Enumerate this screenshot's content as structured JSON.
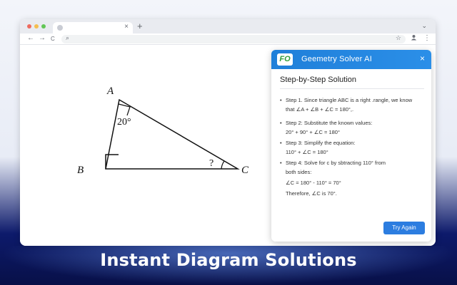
{
  "browser": {
    "tab_close": "×",
    "new_tab": "+",
    "menu": "⌄",
    "nav": {
      "back": "←",
      "forward": "→",
      "reload": "C"
    },
    "search_icon": "⌕",
    "star": "☆",
    "profile_icon": "person-icon",
    "more": "⋮",
    "traffic_light_colors": [
      "#ee6a5f",
      "#f5be4f",
      "#62c655"
    ]
  },
  "diagram": {
    "vertex_a": "A",
    "vertex_b": "B",
    "vertex_c": "C",
    "angle_a": "20°",
    "angle_c": "?"
  },
  "panel": {
    "logo": "FO",
    "title": "Geemetry Solver AI",
    "close": "×",
    "heading": "Step-by-Step Solution",
    "step1_line1": "Step 1. Since triangle ABC is a right .rangle, we know",
    "step1_line2": "that ∠A + ∠B + ∠C = 180°,.",
    "step2_line1": "Step 2: Substitute the known values:",
    "step2_line2": "20° + 90° + ∠C = 180°",
    "step3_line1": "Step 3: Simplify the equation:",
    "step3_line2": "110° + ∠C = 180°",
    "step4_line1": "Step 4: Solve for c by sbtracting 110° from",
    "step4_line2": "both sides:",
    "step4_line3": "∠C = 180° - 110° = 70°",
    "conclusion": "Therefore, ∠C is 70°.",
    "try_again": "Try Again",
    "accent": "#2c7de0"
  },
  "banner": {
    "title": "Instant Diagram Solutions"
  }
}
